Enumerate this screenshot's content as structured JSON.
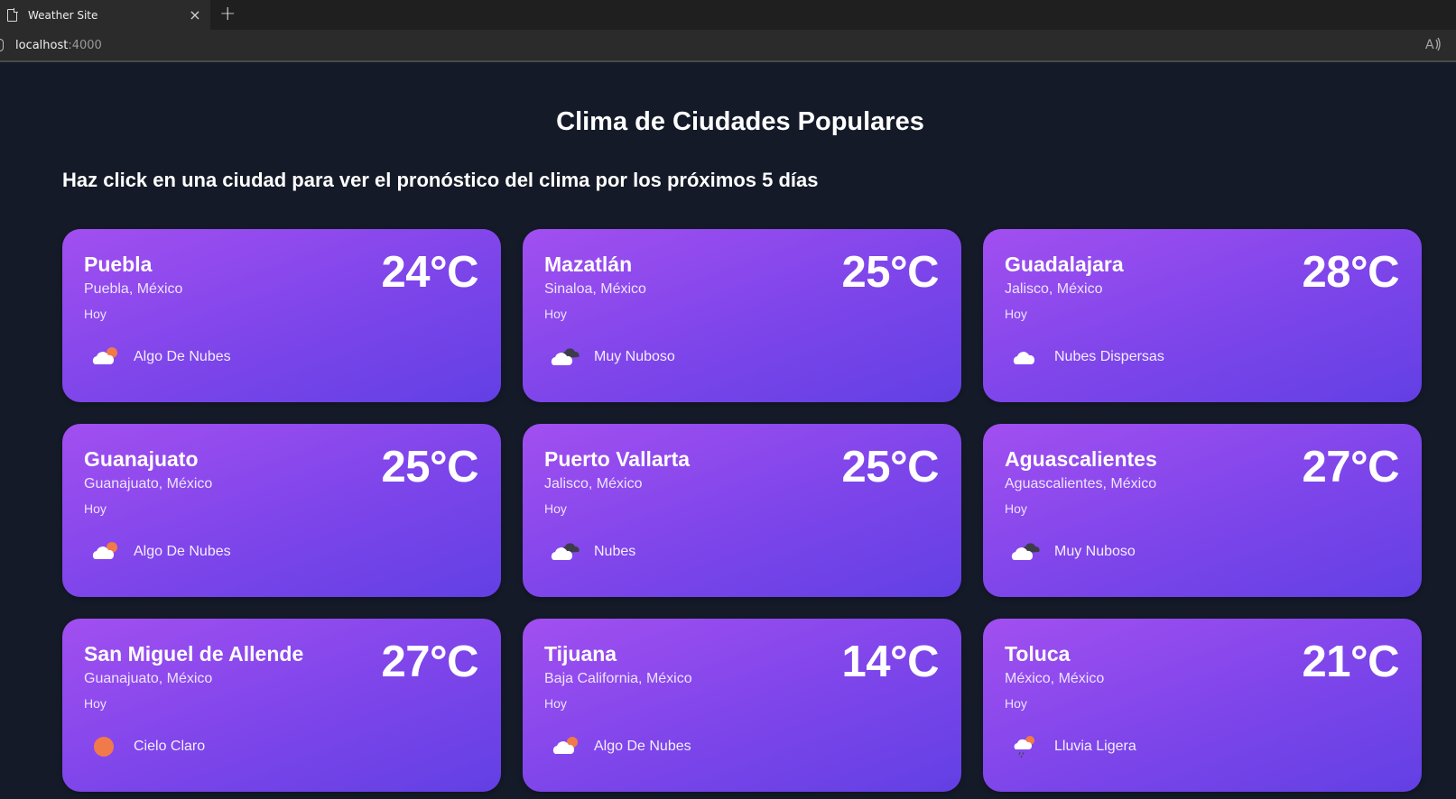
{
  "browser": {
    "tab_title": "Weather Site",
    "tab_close": "×",
    "new_tab": "+",
    "url_host": "localhost",
    "url_port": ":4000",
    "read_aloud": "A)"
  },
  "page": {
    "title": "Clima de Ciudades Populares",
    "subtitle": "Haz click en una ciudad para ver el pronóstico del clima por los próximos 5 días"
  },
  "cities": [
    {
      "name": "Puebla",
      "region": "Puebla, México",
      "day": "Hoy",
      "temp": "24°C",
      "condition": "Algo De Nubes",
      "icon": "few-clouds"
    },
    {
      "name": "Mazatlán",
      "region": "Sinaloa, México",
      "day": "Hoy",
      "temp": "25°C",
      "condition": "Muy Nuboso",
      "icon": "broken-clouds"
    },
    {
      "name": "Guadalajara",
      "region": "Jalisco, México",
      "day": "Hoy",
      "temp": "28°C",
      "condition": "Nubes Dispersas",
      "icon": "scattered-clouds"
    },
    {
      "name": "Guanajuato",
      "region": "Guanajuato, México",
      "day": "Hoy",
      "temp": "25°C",
      "condition": "Algo De Nubes",
      "icon": "few-clouds"
    },
    {
      "name": "Puerto Vallarta",
      "region": "Jalisco, México",
      "day": "Hoy",
      "temp": "25°C",
      "condition": "Nubes",
      "icon": "broken-clouds"
    },
    {
      "name": "Aguascalientes",
      "region": "Aguascalientes, México",
      "day": "Hoy",
      "temp": "27°C",
      "condition": "Muy Nuboso",
      "icon": "broken-clouds"
    },
    {
      "name": "San Miguel de Allende",
      "region": "Guanajuato, México",
      "day": "Hoy",
      "temp": "27°C",
      "condition": "Cielo Claro",
      "icon": "clear-sky"
    },
    {
      "name": "Tijuana",
      "region": "Baja California, México",
      "day": "Hoy",
      "temp": "14°C",
      "condition": "Algo De Nubes",
      "icon": "few-clouds"
    },
    {
      "name": "Toluca",
      "region": "México, México",
      "day": "Hoy",
      "temp": "21°C",
      "condition": "Lluvia Ligera",
      "icon": "light-rain"
    }
  ],
  "colors": {
    "background": "#141a28",
    "card_gradient_start": "#a24ff0",
    "card_gradient_end": "#6240e4",
    "sun": "#f07a4a"
  }
}
